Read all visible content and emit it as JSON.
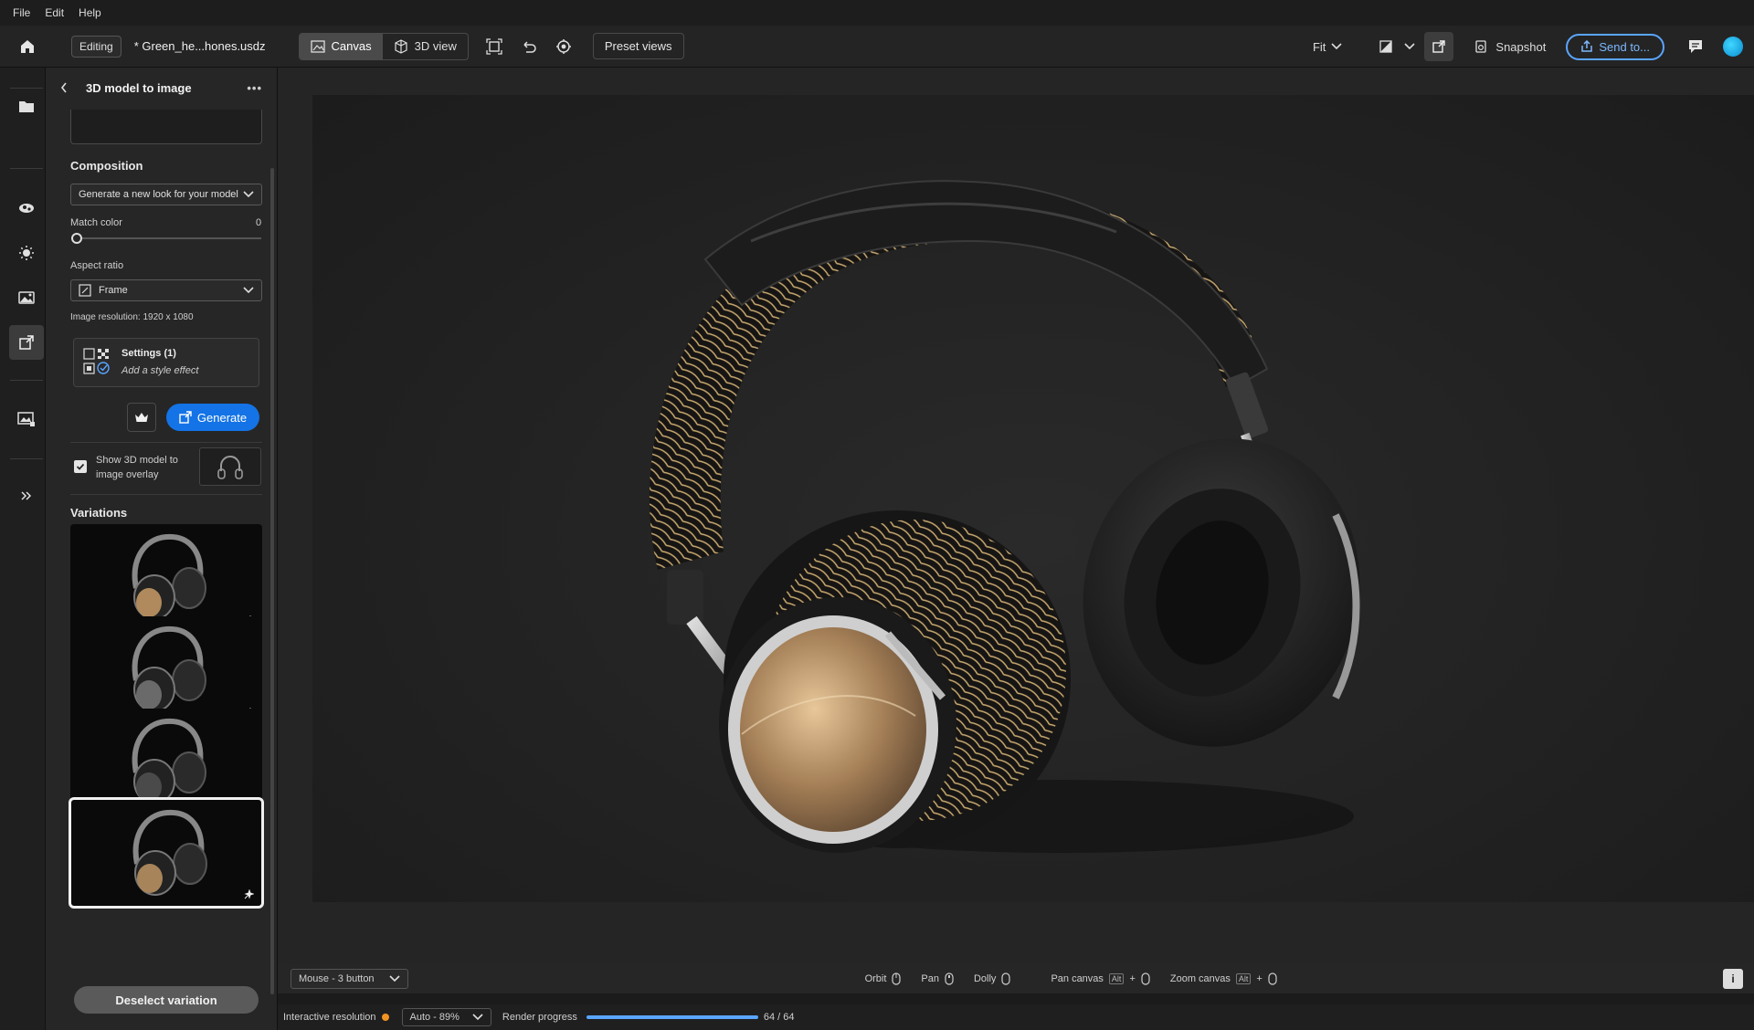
{
  "menu": [
    "File",
    "Edit",
    "Help"
  ],
  "toolbar": {
    "mode_badge": "Editing",
    "filename": "* Green_he...hones.usdz",
    "canvas_label": "Canvas",
    "view3d_label": "3D view",
    "preset_views": "Preset views",
    "fit_label": "Fit",
    "snapshot_label": "Snapshot",
    "send_to_label": "Send to..."
  },
  "panel": {
    "title": "3D model to image",
    "composition_heading": "Composition",
    "composition_value": "Generate a new look for your model",
    "match_color_label": "Match color",
    "match_color_value": "0",
    "aspect_ratio_label": "Aspect ratio",
    "aspect_ratio_value": "Frame",
    "image_resolution": "Image resolution: 1920 x 1080",
    "settings_title": "Settings (1)",
    "settings_sub": "Add a style effect",
    "generate_label": "Generate",
    "overlay_label_1": "Show 3D model to",
    "overlay_label_2": "image overlay",
    "overlay_checked": true,
    "variations_heading": "Variations",
    "variations_count": 4,
    "selected_variation": 4,
    "deselect_label": "Deselect variation"
  },
  "bottombar": {
    "mouse_mode": "Mouse - 3 button",
    "orbit": "Orbit",
    "pan": "Pan",
    "dolly": "Dolly",
    "pan_canvas": "Pan canvas",
    "zoom_canvas": "Zoom canvas",
    "alt_key": "Alt",
    "plus": "+"
  },
  "statusbar": {
    "interactive_resolution": "Interactive resolution",
    "resolution_value": "Auto - 89%",
    "render_progress_label": "Render progress",
    "render_progress_text": "64 / 64",
    "render_progress_fraction": 1.0
  },
  "colors": {
    "accent": "#1473e6",
    "send_to_outline": "#5aa5ff",
    "status_dot": "#f29423"
  }
}
